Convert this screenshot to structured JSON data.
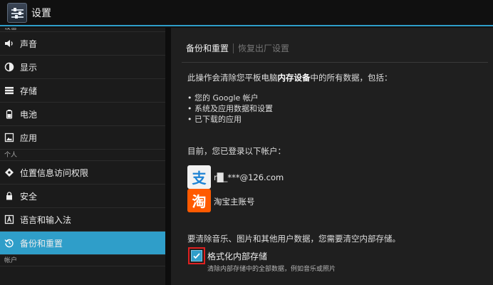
{
  "actionbar": {
    "title": "设置"
  },
  "sidebar": {
    "categories": {
      "top": "设备",
      "personal": "个人",
      "accounts": "帐户"
    },
    "items": [
      {
        "label": "声音",
        "icon": "speaker-icon"
      },
      {
        "label": "显示",
        "icon": "brightness-icon"
      },
      {
        "label": "存储",
        "icon": "storage-icon"
      },
      {
        "label": "电池",
        "icon": "battery-icon"
      },
      {
        "label": "应用",
        "icon": "apps-icon"
      },
      {
        "label": "位置信息访问权限",
        "icon": "location-icon"
      },
      {
        "label": "安全",
        "icon": "lock-icon"
      },
      {
        "label": "语言和输入法",
        "icon": "keyboard-icon"
      },
      {
        "label": "备份和重置",
        "icon": "backup-icon",
        "active": true
      }
    ]
  },
  "content": {
    "breadcrumb_current": "备份和重置",
    "breadcrumb_previous": "恢复出厂设置",
    "intro_before": "此操作会清除您平板电脑",
    "intro_bold": "内存设备",
    "intro_after": "中的所有数据，包括：",
    "bullets": [
      "• 您的 Google 帐户",
      "• 系统及应用数据和设置",
      "• 已下载的应用"
    ],
    "accounts_heading": "目前，您已登录以下帐户：",
    "accounts": [
      {
        "name": "r█_***@126.com",
        "icon_glyph": "支"
      },
      {
        "name": "淘宝主账号",
        "icon_glyph": "淘"
      }
    ],
    "clear_note": "要清除音乐、图片和其他用户数据，您需要清空内部存储。",
    "format_label": "格式化内部存储",
    "format_sub": "清除内部存储中的全部数据，例如音乐或照片",
    "format_checked": true
  },
  "colors": {
    "accent": "#2f9ec9",
    "highlight": "#e02020"
  }
}
